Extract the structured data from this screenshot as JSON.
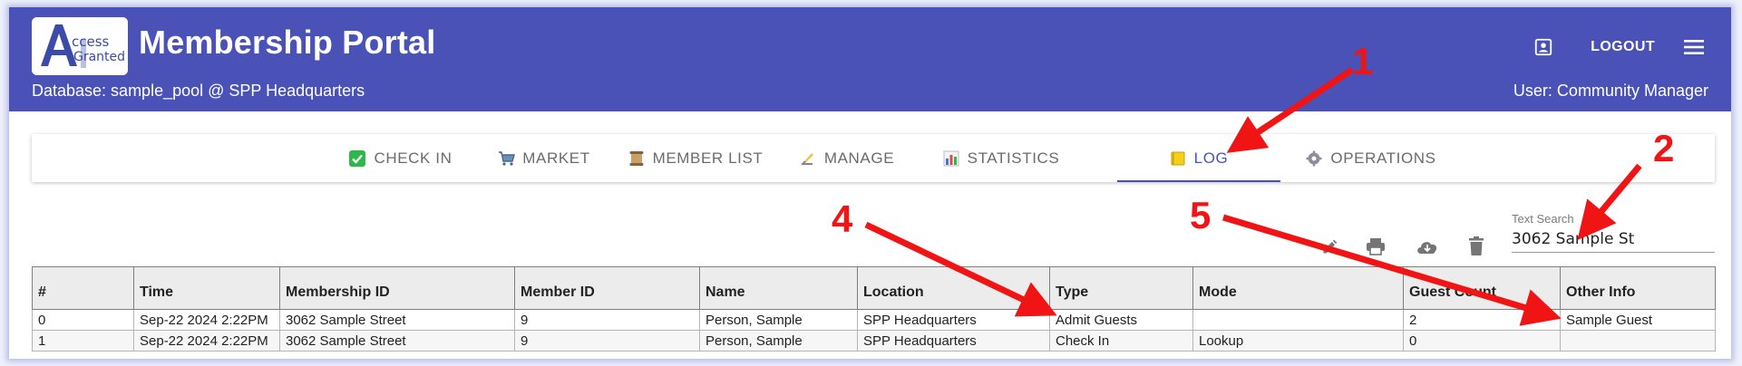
{
  "header": {
    "logo_text": "Access Granted",
    "title": "Membership Portal",
    "database_line": "Database: sample_pool @ SPP Headquarters",
    "user_line": "User: Community Manager",
    "logout_label": "LOGOUT",
    "account_icon": "account-box-icon",
    "menu_icon": "hamburger-menu-icon"
  },
  "tabs": [
    {
      "label": "CHECK IN",
      "icon": "check-mark-icon"
    },
    {
      "label": "MARKET",
      "icon": "shopping-cart-icon"
    },
    {
      "label": "MEMBER LIST",
      "icon": "scroll-icon"
    },
    {
      "label": "MANAGE",
      "icon": "writing-hand-icon"
    },
    {
      "label": "STATISTICS",
      "icon": "bar-chart-icon"
    },
    {
      "label": "LOG",
      "icon": "ledger-icon",
      "active": true
    },
    {
      "label": "OPERATIONS",
      "icon": "gear-icon"
    }
  ],
  "toolbar": {
    "edit_icon": "pencil-icon",
    "print_icon": "printer-icon",
    "download_icon": "cloud-download-icon",
    "delete_icon": "trash-icon"
  },
  "search": {
    "label": "Text Search",
    "value": "3062 Sample St"
  },
  "table": {
    "columns": [
      "#",
      "Time",
      "Membership ID",
      "Member ID",
      "Name",
      "Location",
      "Type",
      "Mode",
      "Guest Count",
      "Other Info"
    ],
    "rows": [
      [
        "0",
        "Sep-22 2024 2:22PM",
        "3062 Sample Street",
        "9",
        "Person, Sample",
        "SPP Headquarters",
        "Admit Guests",
        "",
        "2",
        "Sample Guest"
      ],
      [
        "1",
        "Sep-22 2024 2:22PM",
        "3062 Sample Street",
        "9",
        "Person, Sample",
        "SPP Headquarters",
        "Check In",
        "Lookup",
        "0",
        ""
      ]
    ]
  },
  "annotations": [
    "1",
    "2",
    "4",
    "5"
  ],
  "colors": {
    "header_bg": "#4a52b8",
    "accent": "#4a52b8",
    "annotation_red": "#f01414"
  }
}
